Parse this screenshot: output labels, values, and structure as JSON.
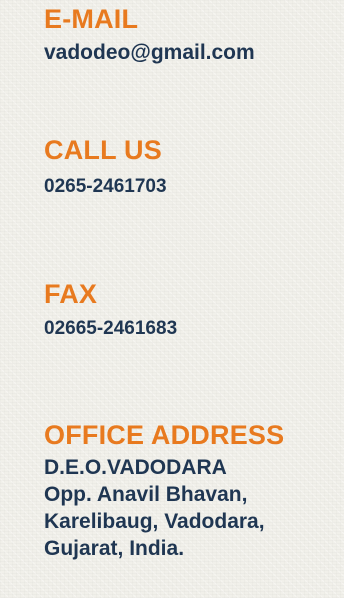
{
  "email": {
    "heading": "E-MAIL",
    "value": "vadodeo@gmail.com"
  },
  "call": {
    "heading": "CALL US",
    "value": "0265-2461703"
  },
  "fax": {
    "heading": "FAX",
    "value": "02665-2461683"
  },
  "address": {
    "heading": "OFFICE ADDRESS",
    "lines": [
      "D.E.O.VADODARA",
      "Opp. Anavil Bhavan,",
      "Karelibaug, Vadodara,",
      "Gujarat, India."
    ]
  },
  "colors": {
    "heading": "#e87a1f",
    "text": "#1f3652",
    "background": "#f1f0ea"
  }
}
